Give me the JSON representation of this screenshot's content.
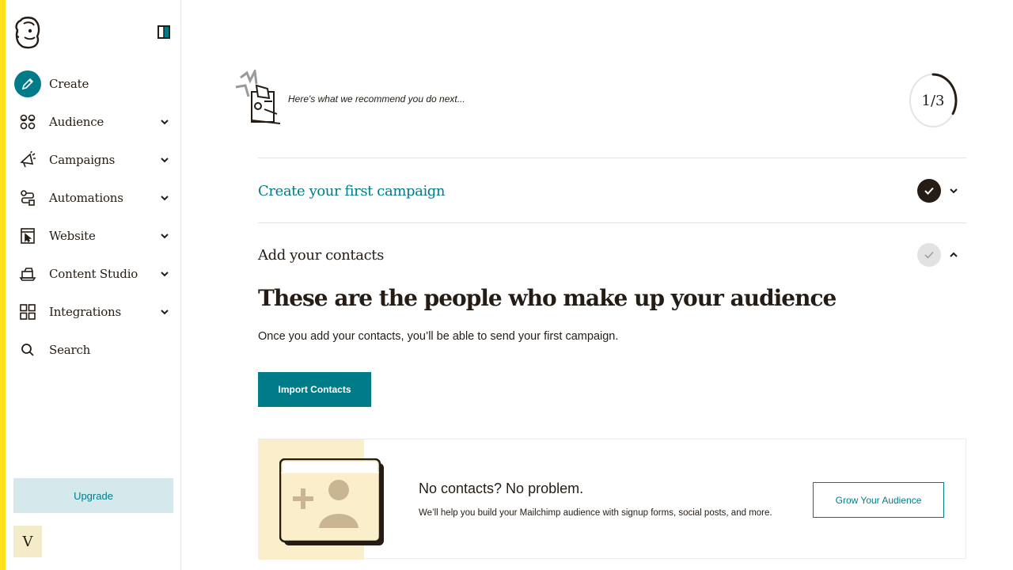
{
  "theme": {
    "accent": "#007c89",
    "brand_yellow": "#ffe01b",
    "text": "#241c15",
    "upgrade_bg": "#d5e9ec",
    "card_art_bg": "#fbeecb"
  },
  "sidebar": {
    "logo_icon": "mailchimp-freddie-icon",
    "collapse_icon": "sidebar-collapse-icon",
    "items": [
      {
        "label": "Create",
        "icon": "pencil-icon",
        "has_chevron": false,
        "active": true
      },
      {
        "label": "Audience",
        "icon": "audience-icon",
        "has_chevron": true
      },
      {
        "label": "Campaigns",
        "icon": "megaphone-icon",
        "has_chevron": true
      },
      {
        "label": "Automations",
        "icon": "automation-flow-icon",
        "has_chevron": true
      },
      {
        "label": "Website",
        "icon": "website-cursor-icon",
        "has_chevron": true
      },
      {
        "label": "Content Studio",
        "icon": "content-stack-icon",
        "has_chevron": true
      },
      {
        "label": "Integrations",
        "icon": "grid-icon",
        "has_chevron": true
      },
      {
        "label": "Search",
        "icon": "search-icon",
        "has_chevron": false
      }
    ],
    "upgrade_label": "Upgrade",
    "avatar_initial": "V"
  },
  "main": {
    "recommendation_text": "Here's what we recommend you do next...",
    "progress": {
      "label": "1/3",
      "fraction": 0.3333
    },
    "steps": [
      {
        "title": "Create your first campaign",
        "completed": true,
        "expanded": false
      },
      {
        "title": "Add your contacts",
        "completed": false,
        "expanded": true
      }
    ],
    "headline": "These are the people who make up your audience",
    "subtext": "Once you add your contacts, you’ll be able to send your first campaign.",
    "import_button": "Import Contacts",
    "card": {
      "title": "No contacts? No problem.",
      "description": "We’ll help you build your Mailchimp audience with signup forms, social posts, and more.",
      "button": "Grow Your Audience",
      "art_icon": "add-contact-card-icon"
    }
  }
}
